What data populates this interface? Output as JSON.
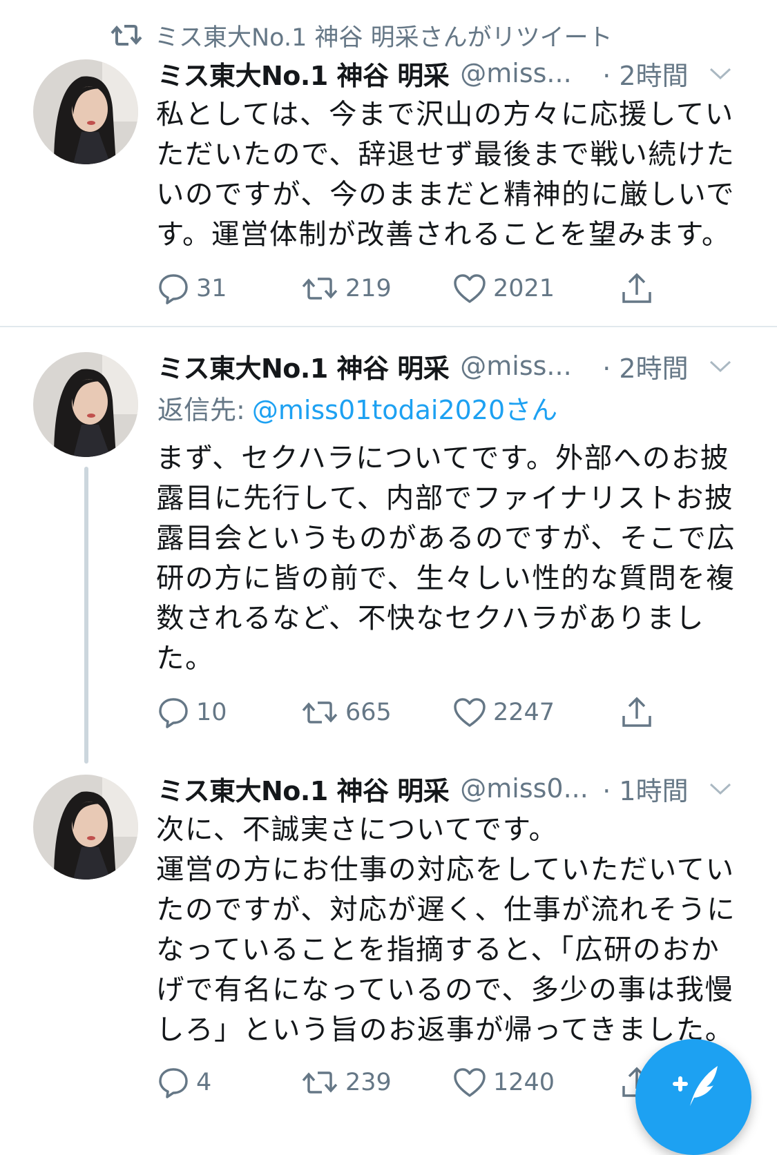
{
  "retweet_context": {
    "icon": "retweet-icon",
    "text": "ミス東大No.1 神谷 明采さんがリツイート"
  },
  "colors": {
    "accent": "#1da1f2",
    "secondary_text": "#657786",
    "primary_text": "#14171a",
    "divider": "#e1e8ed"
  },
  "tweets": [
    {
      "name": "ミス東大No.1 神谷 明采",
      "handle": "@miss...",
      "time": "· 2時間",
      "reply_label": "",
      "reply_to": "",
      "text": "私としては、今まで沢山の方々に応援していただいたので、辞退せず最後まで戦い続けたいのですが、今のままだと精神的に厳しいです。運営体制が改善されることを望みます。",
      "replies": "31",
      "retweets": "219",
      "likes": "2021"
    },
    {
      "name": "ミス東大No.1 神谷 明采",
      "handle": "@miss...",
      "time": "· 2時間",
      "reply_label": "返信先:",
      "reply_to": "@miss01todai2020さん",
      "text": "まず、セクハラについてです。外部へのお披露目に先行して、内部でファイナリストお披露目会というものがあるのですが、そこで広研の方に皆の前で、生々しい性的な質問を複数されるなど、不快なセクハラがありました。",
      "replies": "10",
      "retweets": "665",
      "likes": "2247"
    },
    {
      "name": "ミス東大No.1 神谷 明采",
      "handle": "@miss0...",
      "time": "· 1時間",
      "reply_label": "",
      "reply_to": "",
      "text": "次に、不誠実さについてです。\n運営の方にお仕事の対応をしていただいていたのですが、対応が遅く、仕事が流れそうになっていることを指摘すると、「広研のおかげで有名になっているので、多少の事は我慢しろ」という旨のお返事が帰ってきました。",
      "replies": "4",
      "retweets": "239",
      "likes": "1240"
    }
  ],
  "fab": {
    "icon": "compose-tweet-icon"
  }
}
